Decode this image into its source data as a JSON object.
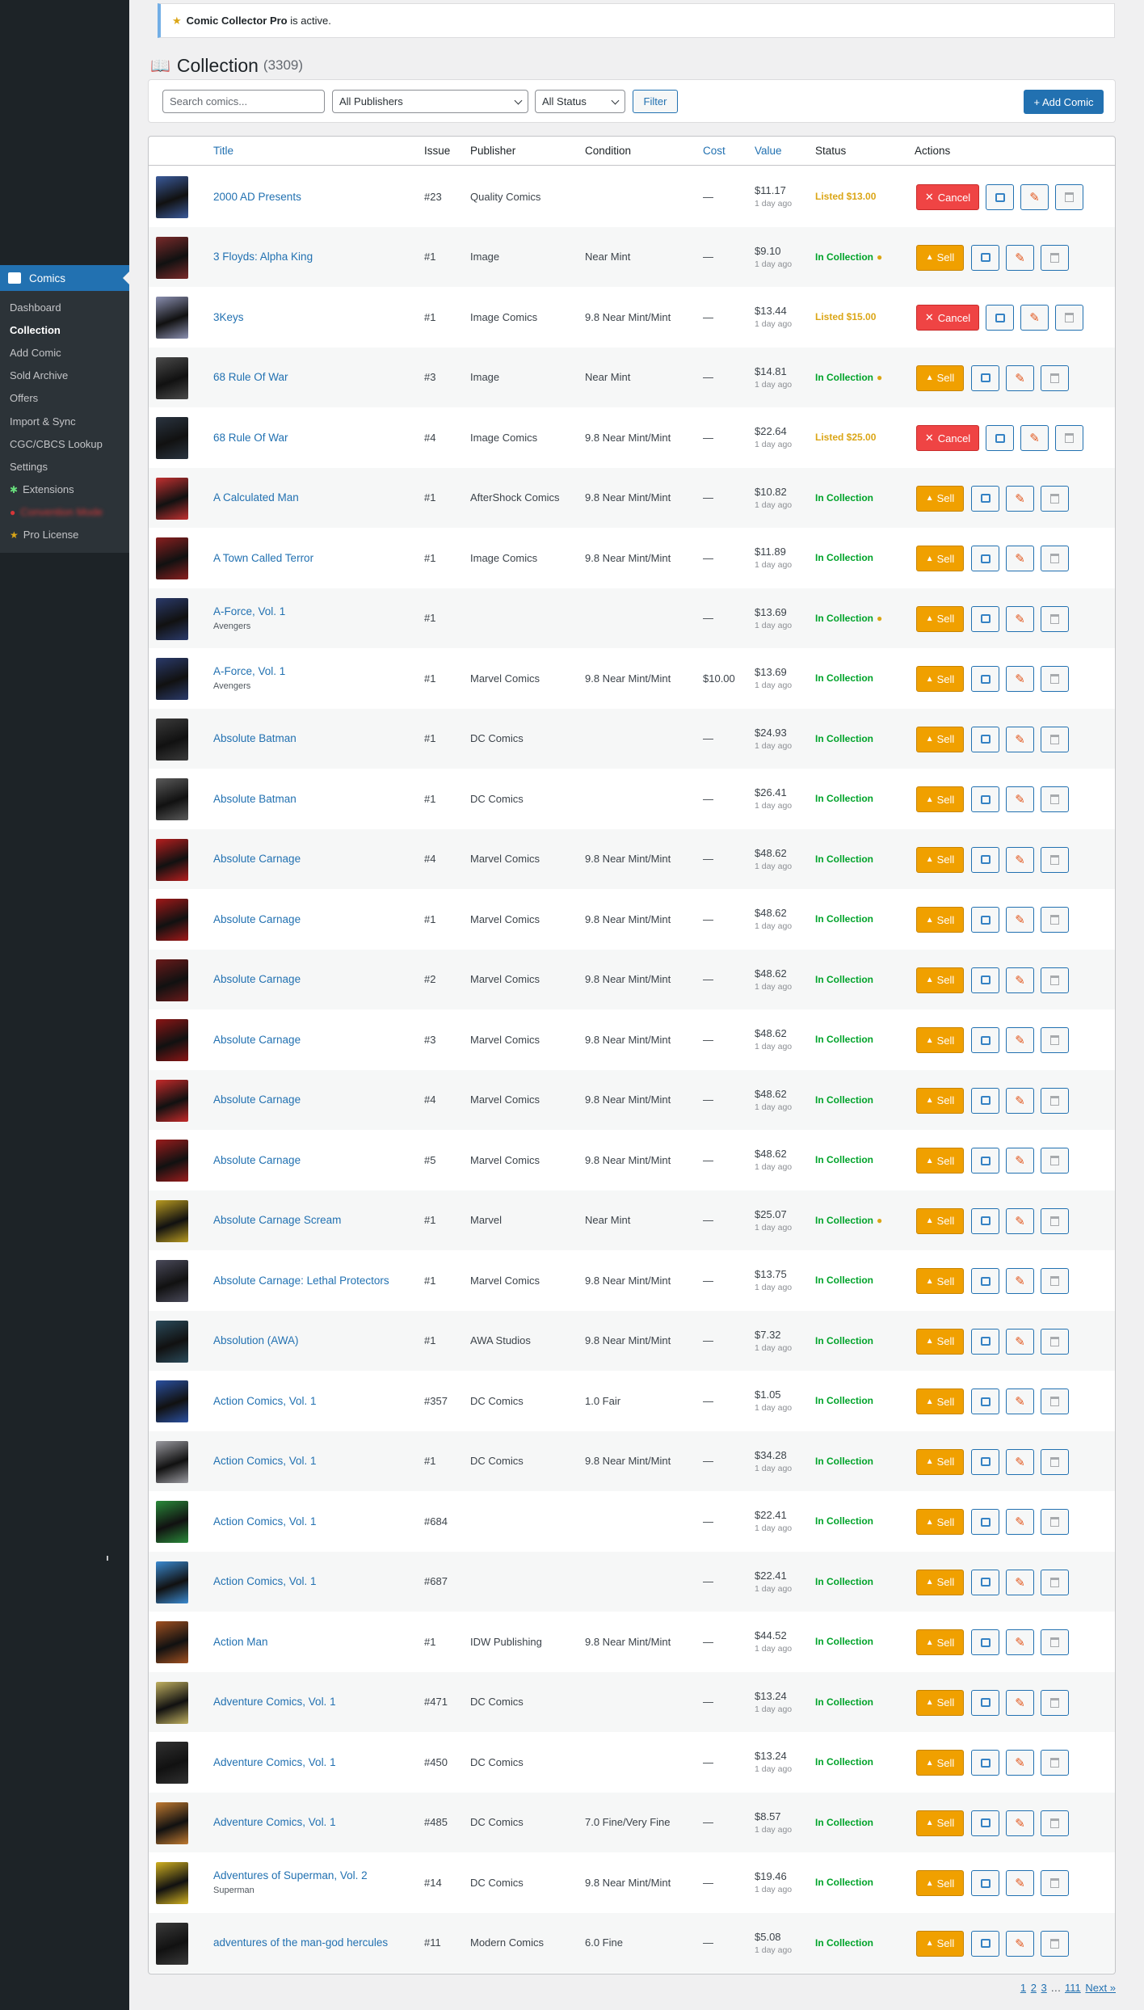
{
  "sidebar": {
    "title": "Comics",
    "items": [
      {
        "label": "Dashboard",
        "current": false,
        "icon": ""
      },
      {
        "label": "Collection",
        "current": true,
        "icon": ""
      },
      {
        "label": "Add Comic",
        "current": false,
        "icon": ""
      },
      {
        "label": "Sold Archive",
        "current": false,
        "icon": ""
      },
      {
        "label": "Offers",
        "current": false,
        "icon": ""
      },
      {
        "label": "Import & Sync",
        "current": false,
        "icon": ""
      },
      {
        "label": "CGC/CBCS Lookup",
        "current": false,
        "icon": ""
      },
      {
        "label": "Settings",
        "current": false,
        "icon": ""
      },
      {
        "label": "Extensions",
        "current": false,
        "icon": "puzzle-icon"
      },
      {
        "label": "Convention Mode",
        "current": false,
        "icon": "blurred-icon"
      },
      {
        "label": "Pro License",
        "current": false,
        "icon": "star-icon"
      }
    ]
  },
  "notice": {
    "bold": "Comic Collector Pro",
    "text": " is active."
  },
  "page": {
    "title": "Collection",
    "count": "(3309)"
  },
  "toolbar": {
    "search_placeholder": "Search comics...",
    "publisher_select": "All Publishers",
    "status_select": "All Status",
    "filter_label": "Filter",
    "add_label": "+ Add Comic"
  },
  "table": {
    "headers": {
      "title": "Title",
      "issue": "Issue",
      "publisher": "Publisher",
      "condition": "Condition",
      "cost": "Cost",
      "value": "Value",
      "status": "Status",
      "actions": "Actions"
    },
    "sell_label": "Sell",
    "cancel_label": "Cancel",
    "rows": [
      {
        "title": "2000 AD Presents",
        "series": "",
        "issue": "#23",
        "publisher": "Quality Comics",
        "condition": "",
        "cost": "—",
        "value": "$11.17",
        "value_date": "1 day ago",
        "status": "Listed $13.00",
        "status_type": "listed",
        "badge": false,
        "action": "cancel",
        "cover": "#3a5a9a"
      },
      {
        "title": "3 Floyds: Alpha King",
        "series": "",
        "issue": "#1",
        "publisher": "Image",
        "condition": "Near Mint",
        "cost": "—",
        "value": "$9.10",
        "value_date": "1 day ago",
        "status": "In Collection",
        "status_type": "in",
        "badge": true,
        "action": "sell",
        "cover": "#7a2a2a"
      },
      {
        "title": "3Keys",
        "series": "",
        "issue": "#1",
        "publisher": "Image Comics",
        "condition": "9.8 Near Mint/Mint",
        "cost": "—",
        "value": "$13.44",
        "value_date": "1 day ago",
        "status": "Listed $15.00",
        "status_type": "listed",
        "badge": false,
        "action": "cancel",
        "cover": "#8a8fb0"
      },
      {
        "title": "68 Rule Of War",
        "series": "",
        "issue": "#3",
        "publisher": "Image",
        "condition": "Near Mint",
        "cost": "—",
        "value": "$14.81",
        "value_date": "1 day ago",
        "status": "In Collection",
        "status_type": "in",
        "badge": true,
        "action": "sell",
        "cover": "#4a4a4a"
      },
      {
        "title": "68 Rule Of War",
        "series": "",
        "issue": "#4",
        "publisher": "Image Comics",
        "condition": "9.8 Near Mint/Mint",
        "cost": "—",
        "value": "$22.64",
        "value_date": "1 day ago",
        "status": "Listed $25.00",
        "status_type": "listed",
        "badge": false,
        "action": "cancel",
        "cover": "#2a3440"
      },
      {
        "title": "A Calculated Man",
        "series": "",
        "issue": "#1",
        "publisher": "AfterShock Comics",
        "condition": "9.8 Near Mint/Mint",
        "cost": "—",
        "value": "$10.82",
        "value_date": "1 day ago",
        "status": "In Collection",
        "status_type": "in",
        "badge": false,
        "action": "sell",
        "cover": "#c23030"
      },
      {
        "title": "A Town Called Terror",
        "series": "",
        "issue": "#1",
        "publisher": "Image Comics",
        "condition": "9.8 Near Mint/Mint",
        "cost": "—",
        "value": "$11.89",
        "value_date": "1 day ago",
        "status": "In Collection",
        "status_type": "in",
        "badge": false,
        "action": "sell",
        "cover": "#8a1f1f"
      },
      {
        "title": "A-Force, Vol. 1",
        "series": "Avengers",
        "issue": "#1",
        "publisher": "",
        "condition": "",
        "cost": "—",
        "value": "$13.69",
        "value_date": "1 day ago",
        "status": "In Collection",
        "status_type": "in",
        "badge": true,
        "action": "sell",
        "cover": "#2a3a6a"
      },
      {
        "title": "A-Force, Vol. 1",
        "series": "Avengers",
        "issue": "#1",
        "publisher": "Marvel Comics",
        "condition": "9.8 Near Mint/Mint",
        "cost": "$10.00",
        "value": "$13.69",
        "value_date": "1 day ago",
        "status": "In Collection",
        "status_type": "in",
        "badge": false,
        "action": "sell",
        "cover": "#2a3a6a"
      },
      {
        "title": "Absolute Batman",
        "series": "",
        "issue": "#1",
        "publisher": "DC Comics",
        "condition": "",
        "cost": "—",
        "value": "$24.93",
        "value_date": "1 day ago",
        "status": "In Collection",
        "status_type": "in",
        "badge": false,
        "action": "sell",
        "cover": "#3a3a3a"
      },
      {
        "title": "Absolute Batman",
        "series": "",
        "issue": "#1",
        "publisher": "DC Comics",
        "condition": "",
        "cost": "—",
        "value": "$26.41",
        "value_date": "1 day ago",
        "status": "In Collection",
        "status_type": "in",
        "badge": false,
        "action": "sell",
        "cover": "#5a5a5a"
      },
      {
        "title": "Absolute Carnage",
        "series": "",
        "issue": "#4",
        "publisher": "Marvel Comics",
        "condition": "9.8 Near Mint/Mint",
        "cost": "—",
        "value": "$48.62",
        "value_date": "1 day ago",
        "status": "In Collection",
        "status_type": "in",
        "badge": false,
        "action": "sell",
        "cover": "#b51e1e"
      },
      {
        "title": "Absolute Carnage",
        "series": "",
        "issue": "#1",
        "publisher": "Marvel Comics",
        "condition": "9.8 Near Mint/Mint",
        "cost": "—",
        "value": "$48.62",
        "value_date": "1 day ago",
        "status": "In Collection",
        "status_type": "in",
        "badge": false,
        "action": "sell",
        "cover": "#a01818"
      },
      {
        "title": "Absolute Carnage",
        "series": "",
        "issue": "#2",
        "publisher": "Marvel Comics",
        "condition": "9.8 Near Mint/Mint",
        "cost": "—",
        "value": "$48.62",
        "value_date": "1 day ago",
        "status": "In Collection",
        "status_type": "in",
        "badge": false,
        "action": "sell",
        "cover": "#6a1a1a"
      },
      {
        "title": "Absolute Carnage",
        "series": "",
        "issue": "#3",
        "publisher": "Marvel Comics",
        "condition": "9.8 Near Mint/Mint",
        "cost": "—",
        "value": "$48.62",
        "value_date": "1 day ago",
        "status": "In Collection",
        "status_type": "in",
        "badge": false,
        "action": "sell",
        "cover": "#8a1515"
      },
      {
        "title": "Absolute Carnage",
        "series": "",
        "issue": "#4",
        "publisher": "Marvel Comics",
        "condition": "9.8 Near Mint/Mint",
        "cost": "—",
        "value": "$48.62",
        "value_date": "1 day ago",
        "status": "In Collection",
        "status_type": "in",
        "badge": false,
        "action": "sell",
        "cover": "#c42a2a"
      },
      {
        "title": "Absolute Carnage",
        "series": "",
        "issue": "#5",
        "publisher": "Marvel Comics",
        "condition": "9.8 Near Mint/Mint",
        "cost": "—",
        "value": "$48.62",
        "value_date": "1 day ago",
        "status": "In Collection",
        "status_type": "in",
        "badge": false,
        "action": "sell",
        "cover": "#9a1c1c"
      },
      {
        "title": "Absolute Carnage Scream",
        "series": "",
        "issue": "#1",
        "publisher": "Marvel",
        "condition": "Near Mint",
        "cost": "—",
        "value": "$25.07",
        "value_date": "1 day ago",
        "status": "In Collection",
        "status_type": "in",
        "badge": true,
        "action": "sell",
        "cover": "#b89a20"
      },
      {
        "title": "Absolute Carnage: Lethal Protectors",
        "series": "",
        "issue": "#1",
        "publisher": "Marvel Comics",
        "condition": "9.8 Near Mint/Mint",
        "cost": "—",
        "value": "$13.75",
        "value_date": "1 day ago",
        "status": "In Collection",
        "status_type": "in",
        "badge": false,
        "action": "sell",
        "cover": "#4a4a5a"
      },
      {
        "title": "Absolution (AWA)",
        "series": "",
        "issue": "#1",
        "publisher": "AWA Studios",
        "condition": "9.8 Near Mint/Mint",
        "cost": "—",
        "value": "$7.32",
        "value_date": "1 day ago",
        "status": "In Collection",
        "status_type": "in",
        "badge": false,
        "action": "sell",
        "cover": "#2a4a5a"
      },
      {
        "title": "Action Comics, Vol. 1",
        "series": "",
        "issue": "#357",
        "publisher": "DC Comics",
        "condition": "1.0 Fair",
        "cost": "—",
        "value": "$1.05",
        "value_date": "1 day ago",
        "status": "In Collection",
        "status_type": "in",
        "badge": false,
        "action": "sell",
        "cover": "#2a50a0"
      },
      {
        "title": "Action Comics, Vol. 1",
        "series": "",
        "issue": "#1",
        "publisher": "DC Comics",
        "condition": "9.8 Near Mint/Mint",
        "cost": "—",
        "value": "$34.28",
        "value_date": "1 day ago",
        "status": "In Collection",
        "status_type": "in",
        "badge": false,
        "action": "sell",
        "cover": "#9a9aa0"
      },
      {
        "title": "Action Comics, Vol. 1",
        "series": "",
        "issue": "#684",
        "publisher": "",
        "condition": "",
        "cost": "—",
        "value": "$22.41",
        "value_date": "1 day ago",
        "status": "In Collection",
        "status_type": "in",
        "badge": false,
        "action": "sell",
        "cover": "#2a8a3a"
      },
      {
        "title": "Action Comics, Vol. 1",
        "series": "",
        "issue": "#687",
        "publisher": "",
        "condition": "",
        "cost": "—",
        "value": "$22.41",
        "value_date": "1 day ago",
        "status": "In Collection",
        "status_type": "in",
        "badge": false,
        "action": "sell",
        "cover": "#3a8ad0"
      },
      {
        "title": "Action Man",
        "series": "",
        "issue": "#1",
        "publisher": "IDW Publishing",
        "condition": "9.8 Near Mint/Mint",
        "cost": "—",
        "value": "$44.52",
        "value_date": "1 day ago",
        "status": "In Collection",
        "status_type": "in",
        "badge": false,
        "action": "sell",
        "cover": "#a05020"
      },
      {
        "title": "Adventure Comics, Vol. 1",
        "series": "",
        "issue": "#471",
        "publisher": "DC Comics",
        "condition": "",
        "cost": "—",
        "value": "$13.24",
        "value_date": "1 day ago",
        "status": "In Collection",
        "status_type": "in",
        "badge": false,
        "action": "sell",
        "cover": "#c0b060"
      },
      {
        "title": "Adventure Comics, Vol. 1",
        "series": "",
        "issue": "#450",
        "publisher": "DC Comics",
        "condition": "",
        "cost": "—",
        "value": "$13.24",
        "value_date": "1 day ago",
        "status": "In Collection",
        "status_type": "in",
        "badge": false,
        "action": "sell",
        "cover": "#303030"
      },
      {
        "title": "Adventure Comics, Vol. 1",
        "series": "",
        "issue": "#485",
        "publisher": "DC Comics",
        "condition": "7.0 Fine/Very Fine",
        "cost": "—",
        "value": "$8.57",
        "value_date": "1 day ago",
        "status": "In Collection",
        "status_type": "in",
        "badge": false,
        "action": "sell",
        "cover": "#c07a30"
      },
      {
        "title": "Adventures of Superman, Vol. 2",
        "series": "Superman",
        "issue": "#14",
        "publisher": "DC Comics",
        "condition": "9.8 Near Mint/Mint",
        "cost": "—",
        "value": "$19.46",
        "value_date": "1 day ago",
        "status": "In Collection",
        "status_type": "in",
        "badge": false,
        "action": "sell",
        "cover": "#d0b020"
      },
      {
        "title": "adventures of the man-god hercules",
        "series": "",
        "issue": "#11",
        "publisher": "Modern Comics",
        "condition": "6.0 Fine",
        "cost": "—",
        "value": "$5.08",
        "value_date": "1 day ago",
        "status": "In Collection",
        "status_type": "in",
        "badge": false,
        "action": "sell",
        "cover": "#3a3a3a"
      }
    ]
  },
  "pagination": {
    "p1": "1",
    "p2": "2",
    "p3": "3",
    "ellipsis": "…",
    "last": "111",
    "next": "Next »"
  }
}
